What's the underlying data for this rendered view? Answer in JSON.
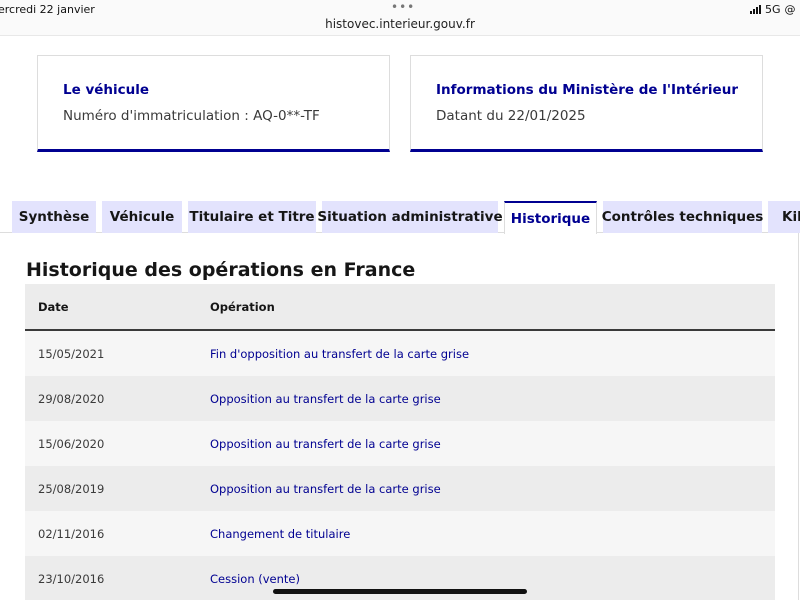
{
  "status_bar": {
    "date": "ercredi 22 janvier",
    "dots": "•••",
    "url": "histovec.interieur.gouv.fr",
    "network": "5G",
    "battery": "6"
  },
  "vehicle_card": {
    "title": "Le véhicule",
    "text": "Numéro d'immatriculation : AQ-0**-TF"
  },
  "ministry_card": {
    "title": "Informations du Ministère de l'Intérieur",
    "text": "Datant du 22/01/2025"
  },
  "tabs": [
    {
      "label": "Synthèse"
    },
    {
      "label": "Véhicule"
    },
    {
      "label": "Titulaire et Titre"
    },
    {
      "label": "Situation administrative"
    },
    {
      "label": "Historique"
    },
    {
      "label": "Contrôles techniques"
    },
    {
      "label": "Kil"
    }
  ],
  "active_tab": "Historique",
  "section": {
    "title": "Historique des opérations en France"
  },
  "table": {
    "columns": [
      "Date",
      "Opération"
    ],
    "rows": [
      {
        "date": "15/05/2021",
        "operation": "Fin d'opposition au transfert de la carte grise"
      },
      {
        "date": "29/08/2020",
        "operation": "Opposition au transfert de la carte grise"
      },
      {
        "date": "15/06/2020",
        "operation": "Opposition au transfert de la carte grise"
      },
      {
        "date": "25/08/2019",
        "operation": "Opposition au transfert de la carte grise"
      },
      {
        "date": "02/11/2016",
        "operation": "Changement de titulaire"
      },
      {
        "date": "23/10/2016",
        "operation": "Cession (vente)"
      }
    ]
  },
  "colors": {
    "accent": "#000091",
    "tab_bg": "#e3e3fd",
    "row_light": "#f6f6f6",
    "row_dark": "#ececec"
  }
}
